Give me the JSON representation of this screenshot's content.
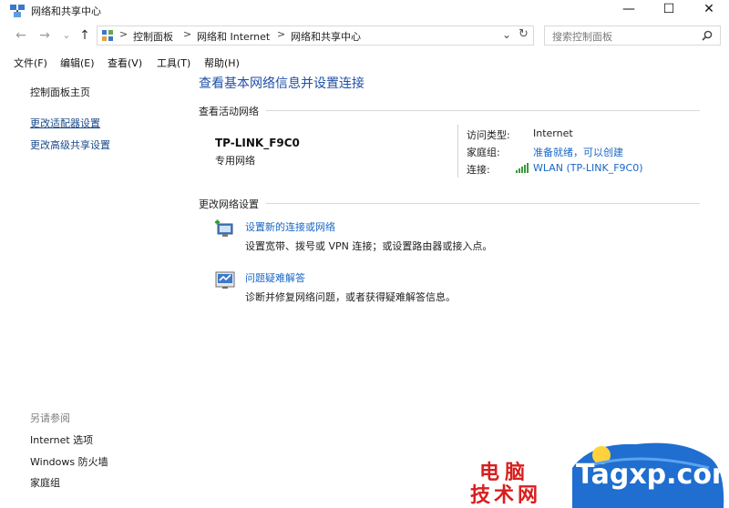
{
  "window": {
    "title": "网络和共享中心",
    "controls": {
      "minimize": "—",
      "maximize": "☐",
      "close": "✕"
    }
  },
  "nav": {
    "back": "←",
    "forward": "→",
    "recent": "⌄",
    "up": "↑",
    "breadcrumbs": [
      "控制面板",
      "网络和 Internet",
      "网络和共享中心"
    ],
    "separator": ">",
    "dropdown": "⌄",
    "refresh": "↻",
    "search_placeholder": "搜索控制面板"
  },
  "menu": [
    "文件(F)",
    "编辑(E)",
    "查看(V)",
    "工具(T)",
    "帮助(H)"
  ],
  "sidebar": {
    "links": [
      "控制面板主页",
      "更改适配器设置",
      "更改高级共享设置"
    ],
    "see_also_label": "另请参阅",
    "see_also": [
      "Internet 选项",
      "Windows 防火墙",
      "家庭组"
    ]
  },
  "main": {
    "title": "查看基本网络信息并设置连接",
    "active_section": "查看活动网络",
    "network": {
      "name": "TP-LINK_F9C0",
      "category": "专用网络",
      "access_type_label": "访问类型:",
      "access_type": "Internet",
      "homegroup_label": "家庭组:",
      "homegroup": "准备就绪，可以创建",
      "connections_label": "连接:",
      "connection": "WLAN (TP-LINK_F9C0)"
    },
    "change_section": "更改网络设置",
    "tasks": [
      {
        "link": "设置新的连接或网络",
        "desc": "设置宽带、拨号或 VPN 连接；或设置路由器或接入点。",
        "icon": "new-connection-icon"
      },
      {
        "link": "问题疑难解答",
        "desc": "诊断并修复网络问题，或者获得疑难解答信息。",
        "icon": "troubleshoot-icon"
      }
    ]
  },
  "watermark": {
    "cn_line1": "电脑",
    "cn_line2": "技术网",
    "site": "Tagxp.com"
  }
}
